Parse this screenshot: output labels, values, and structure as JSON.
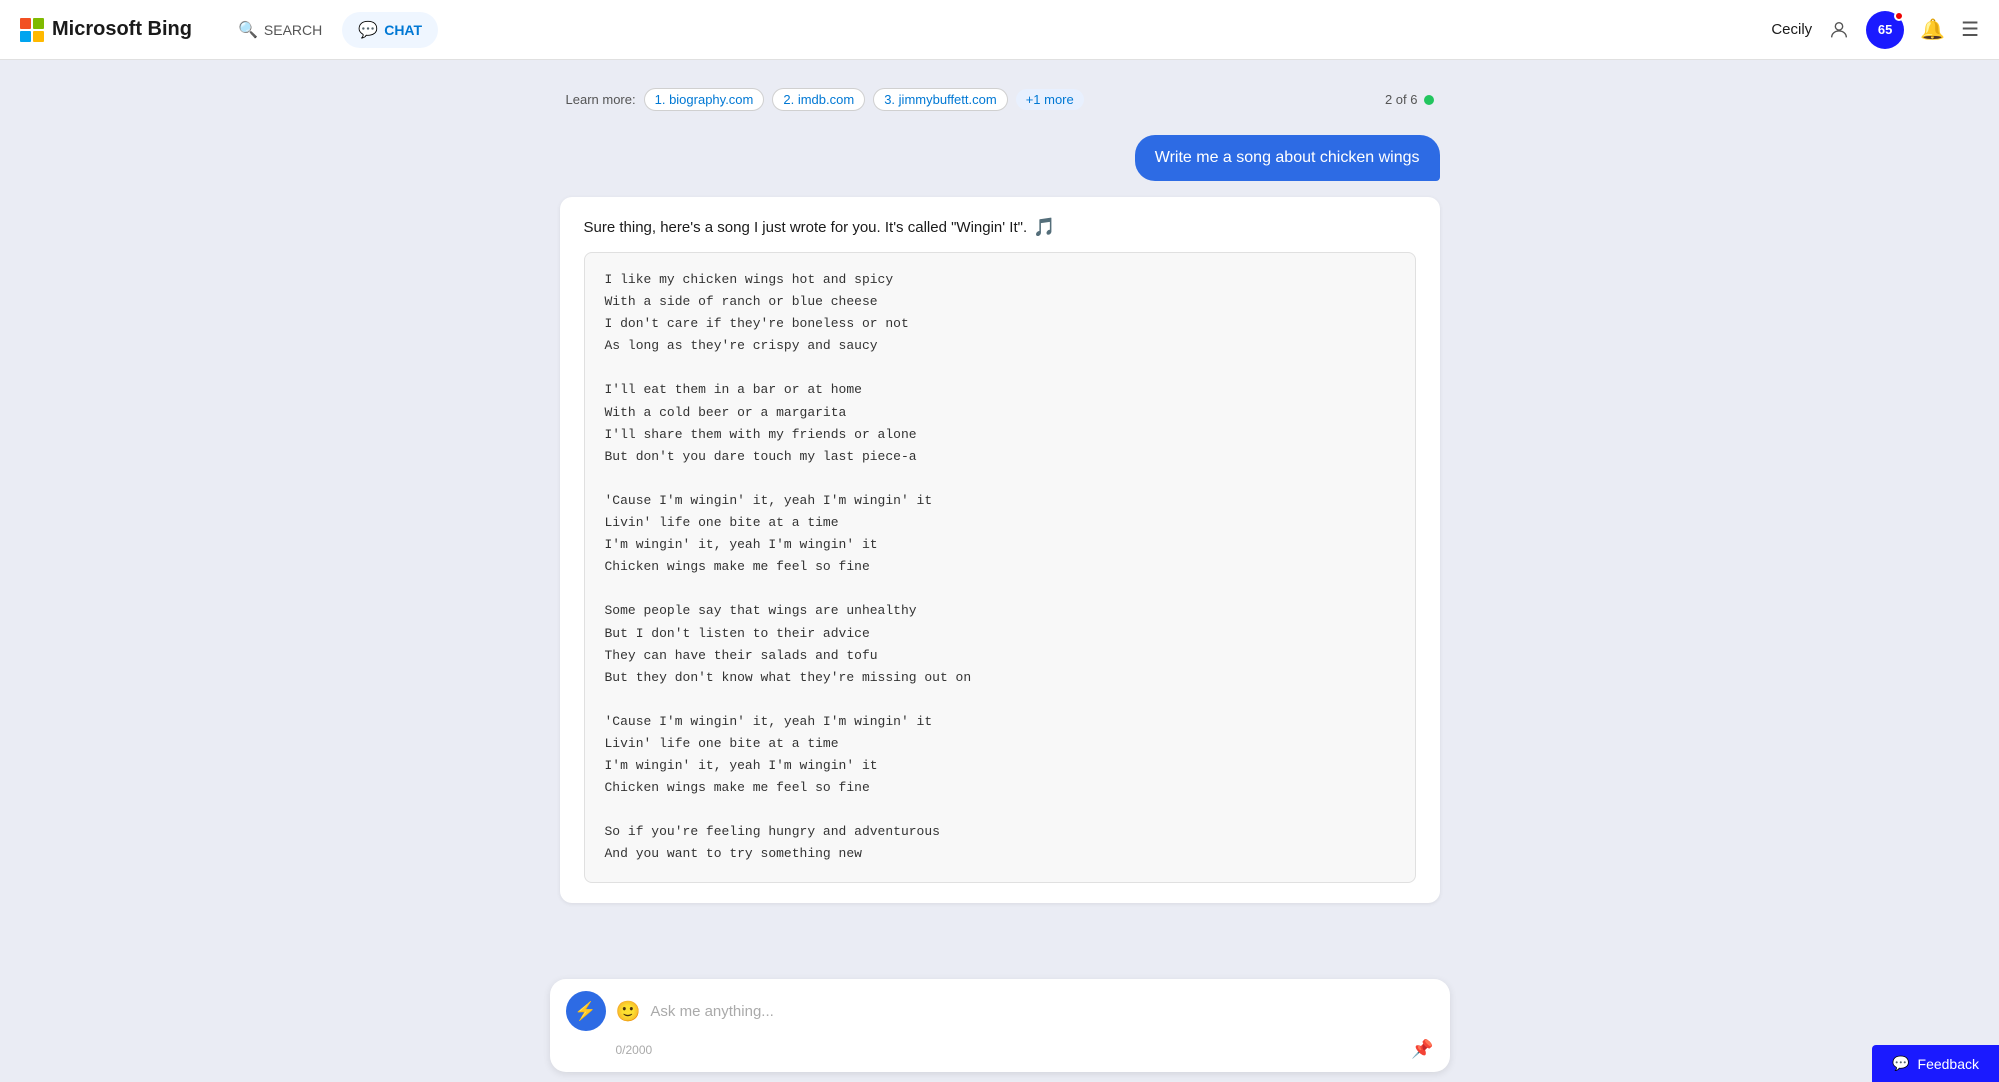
{
  "header": {
    "logo_text": "Microsoft Bing",
    "nav": {
      "search_label": "SEARCH",
      "chat_label": "CHAT"
    },
    "user": {
      "name": "Cecily",
      "score": "65"
    }
  },
  "learn_more": {
    "label": "Learn more:",
    "links": [
      {
        "num": "1.",
        "domain": "biography.com"
      },
      {
        "num": "2.",
        "domain": "imdb.com"
      },
      {
        "num": "3.",
        "domain": "jimmybuffett.com"
      }
    ],
    "more": "+1 more",
    "page": "2 of 6"
  },
  "user_message": "Write me a song about chicken wings",
  "ai_response": {
    "intro": "Sure thing, here's a song I just wrote for you. It's called \"Wingin' It\".",
    "lyrics": "I like my chicken wings hot and spicy\nWith a side of ranch or blue cheese\nI don't care if they're boneless or not\nAs long as they're crispy and saucy\n\nI'll eat them in a bar or at home\nWith a cold beer or a margarita\nI'll share them with my friends or alone\nBut don't you dare touch my last piece-a\n\n'Cause I'm wingin' it, yeah I'm wingin' it\nLivin' life one bite at a time\nI'm wingin' it, yeah I'm wingin' it\nChicken wings make me feel so fine\n\nSome people say that wings are unhealthy\nBut I don't listen to their advice\nThey can have their salads and tofu\nBut they don't know what they're missing out on\n\n'Cause I'm wingin' it, yeah I'm wingin' it\nLivin' life one bite at a time\nI'm wingin' it, yeah I'm wingin' it\nChicken wings make me feel so fine\n\nSo if you're feeling hungry and adventurous\nAnd you want to try something new"
  },
  "input": {
    "placeholder": "Ask me anything...",
    "char_count": "0/2000"
  },
  "feedback": {
    "label": "Feedback"
  }
}
